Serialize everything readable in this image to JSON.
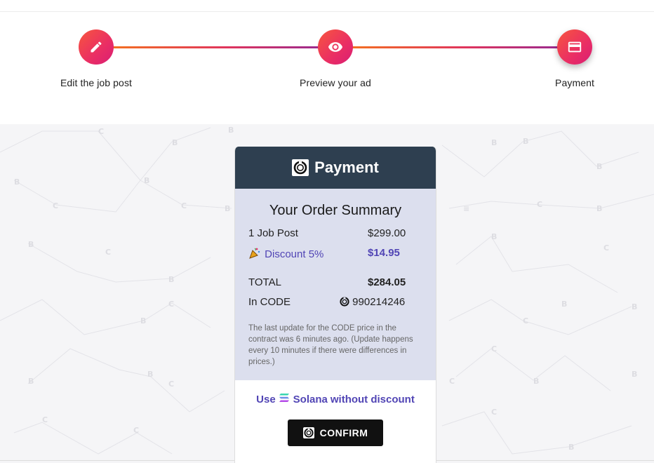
{
  "stepper": {
    "steps": [
      {
        "label": "Edit the job post",
        "icon": "pencil-icon"
      },
      {
        "label": "Preview your ad",
        "icon": "eye-icon"
      },
      {
        "label": "Payment",
        "icon": "credit-card-icon"
      }
    ],
    "current_step": 3
  },
  "card": {
    "header_title": "Payment",
    "header_icon": "code-coin-icon",
    "summary_title": "Your Order Summary",
    "items": {
      "job_post_label": "1 Job Post",
      "job_post_price": "$299.00",
      "discount_label": "Discount 5%",
      "discount_icon": "party-popper-icon",
      "discount_value": "$14.95",
      "total_label": "TOTAL",
      "total_value": "$284.05",
      "in_code_label": "In CODE",
      "in_code_value": "990214246"
    },
    "note": "The last update for the CODE price in the contract was 6 minutes ago. (Update happens every 10 minutes if there were differences in prices.)",
    "alt_payment": {
      "prefix": "Use",
      "currency": "Solana",
      "suffix": "without discount",
      "icon": "solana-icon"
    },
    "confirm_label": "CONFIRM"
  },
  "colors": {
    "accent": "#5145b5",
    "header_bg": "#2e3f50",
    "summary_bg": "#dcdfee",
    "step_gradient_start": "#f7563e",
    "step_gradient_end": "#d91e74"
  }
}
